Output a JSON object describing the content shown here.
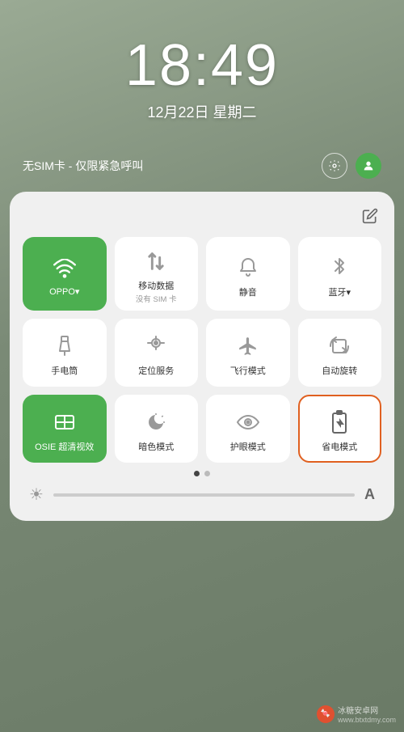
{
  "clock": {
    "time": "18:49",
    "date": "12月22日 星期二"
  },
  "notif_bar": {
    "sim_status": "无SIM卡 - 仅限紧急呼叫"
  },
  "panel": {
    "edit_icon": "✎",
    "rows": [
      [
        {
          "id": "wifi",
          "label": "OPPO▾",
          "sublabel": "",
          "active": true,
          "icon": "wifi"
        },
        {
          "id": "mobile-data",
          "label": "移动数据",
          "sublabel": "没有 SIM 卡",
          "active": false,
          "icon": "bars"
        },
        {
          "id": "silent",
          "label": "静音",
          "sublabel": "",
          "active": false,
          "icon": "bell"
        },
        {
          "id": "bluetooth",
          "label": "蓝牙▾",
          "sublabel": "",
          "active": false,
          "icon": "bluetooth"
        }
      ],
      [
        {
          "id": "flashlight",
          "label": "手电筒",
          "sublabel": "",
          "active": false,
          "icon": "flashlight"
        },
        {
          "id": "location",
          "label": "定位服务",
          "sublabel": "",
          "active": false,
          "icon": "location"
        },
        {
          "id": "airplane",
          "label": "飞行模式",
          "sublabel": "",
          "active": false,
          "icon": "airplane"
        },
        {
          "id": "auto-rotate",
          "label": "自动旋转",
          "sublabel": "",
          "active": false,
          "icon": "rotate"
        }
      ],
      [
        {
          "id": "osie",
          "label": "OSIE 超清视效",
          "sublabel": "",
          "active": true,
          "icon": "osie"
        },
        {
          "id": "dark-mode",
          "label": "暗色模式",
          "sublabel": "",
          "active": false,
          "icon": "dark"
        },
        {
          "id": "eye-care",
          "label": "护眼模式",
          "sublabel": "",
          "active": false,
          "icon": "eye"
        },
        {
          "id": "battery-save",
          "label": "省电模式",
          "sublabel": "",
          "active": false,
          "highlighted": true,
          "icon": "battery-save"
        }
      ]
    ],
    "dots": [
      true,
      false
    ],
    "bottom": {
      "brightness_icon": "☀",
      "font_label": "A"
    }
  },
  "watermark": {
    "text": "冰糖安卓网",
    "url_text": "www.btxtdmy.com"
  }
}
